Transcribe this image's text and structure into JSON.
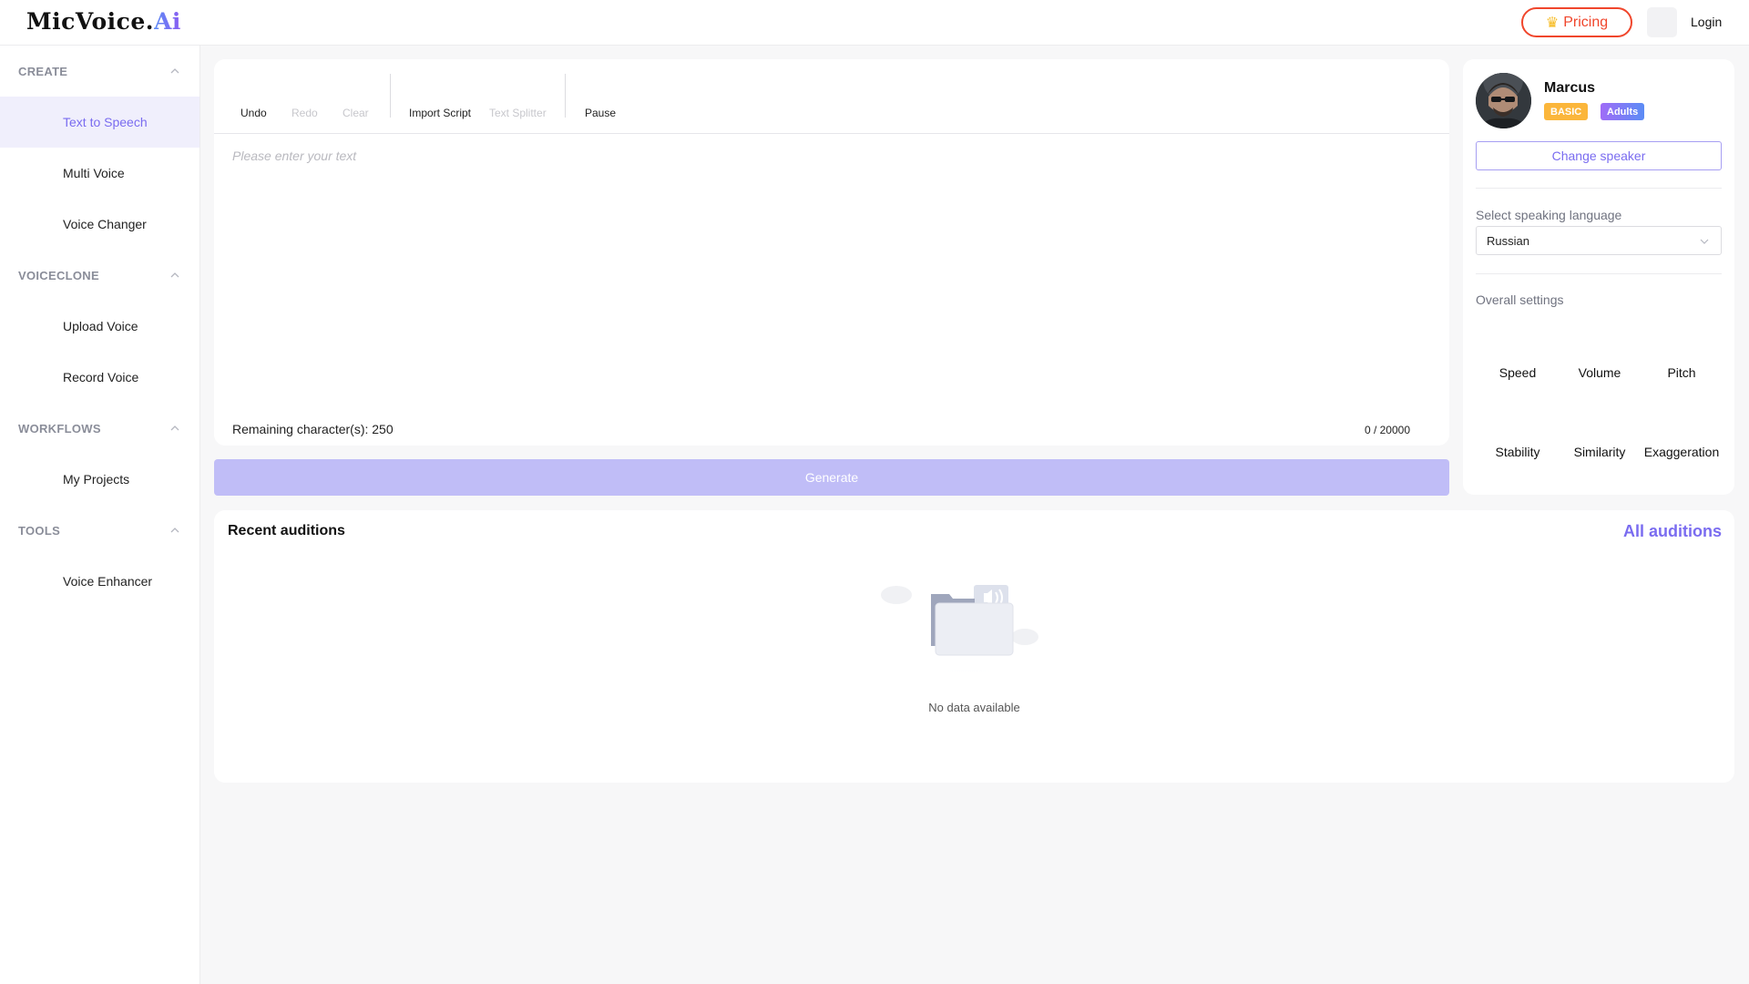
{
  "header": {
    "logo_main": "MicVoice",
    "logo_dot": ".",
    "logo_ai": "Ai",
    "pricing_label": "Pricing",
    "pricing_icon": "crown-icon",
    "login_label": "Login"
  },
  "sidebar": {
    "sections": [
      {
        "label": "CREATE",
        "items": [
          "Text to Speech",
          "Multi Voice",
          "Voice Changer"
        ]
      },
      {
        "label": "VOICECLONE",
        "items": [
          "Upload Voice",
          "Record Voice"
        ]
      },
      {
        "label": "WORKFLOWS",
        "items": [
          "My Projects"
        ]
      },
      {
        "label": "TOOLS",
        "items": [
          "Voice Enhancer"
        ]
      }
    ],
    "active_item": "Text to Speech"
  },
  "toolbar": {
    "undo": "Undo",
    "redo": "Redo",
    "clear": "Clear",
    "import_script": "Import Script",
    "text_splitter": "Text Splitter",
    "pause": "Pause"
  },
  "editor": {
    "placeholder": "Please enter your text",
    "remaining_label": "Remaining character(s): 250",
    "counter": "0 / 20000"
  },
  "generate_label": "Generate",
  "speaker": {
    "name": "Marcus",
    "badge_tier": "BASIC",
    "badge_age": "Adults",
    "change_label": "Change speaker",
    "language_label": "Select speaking language",
    "language_value": "Russian",
    "overall_label": "Overall settings",
    "settings": [
      "Speed",
      "Volume",
      "Pitch",
      "Stability",
      "Similarity",
      "Exaggeration"
    ]
  },
  "recent": {
    "title": "Recent auditions",
    "all_link": "All auditions",
    "empty_text": "No data available"
  },
  "colors": {
    "accent": "#7a6cf0",
    "generate_disabled": "#c0bdf7",
    "pricing": "#f0462c",
    "badge_basic": "#fbb63b"
  }
}
